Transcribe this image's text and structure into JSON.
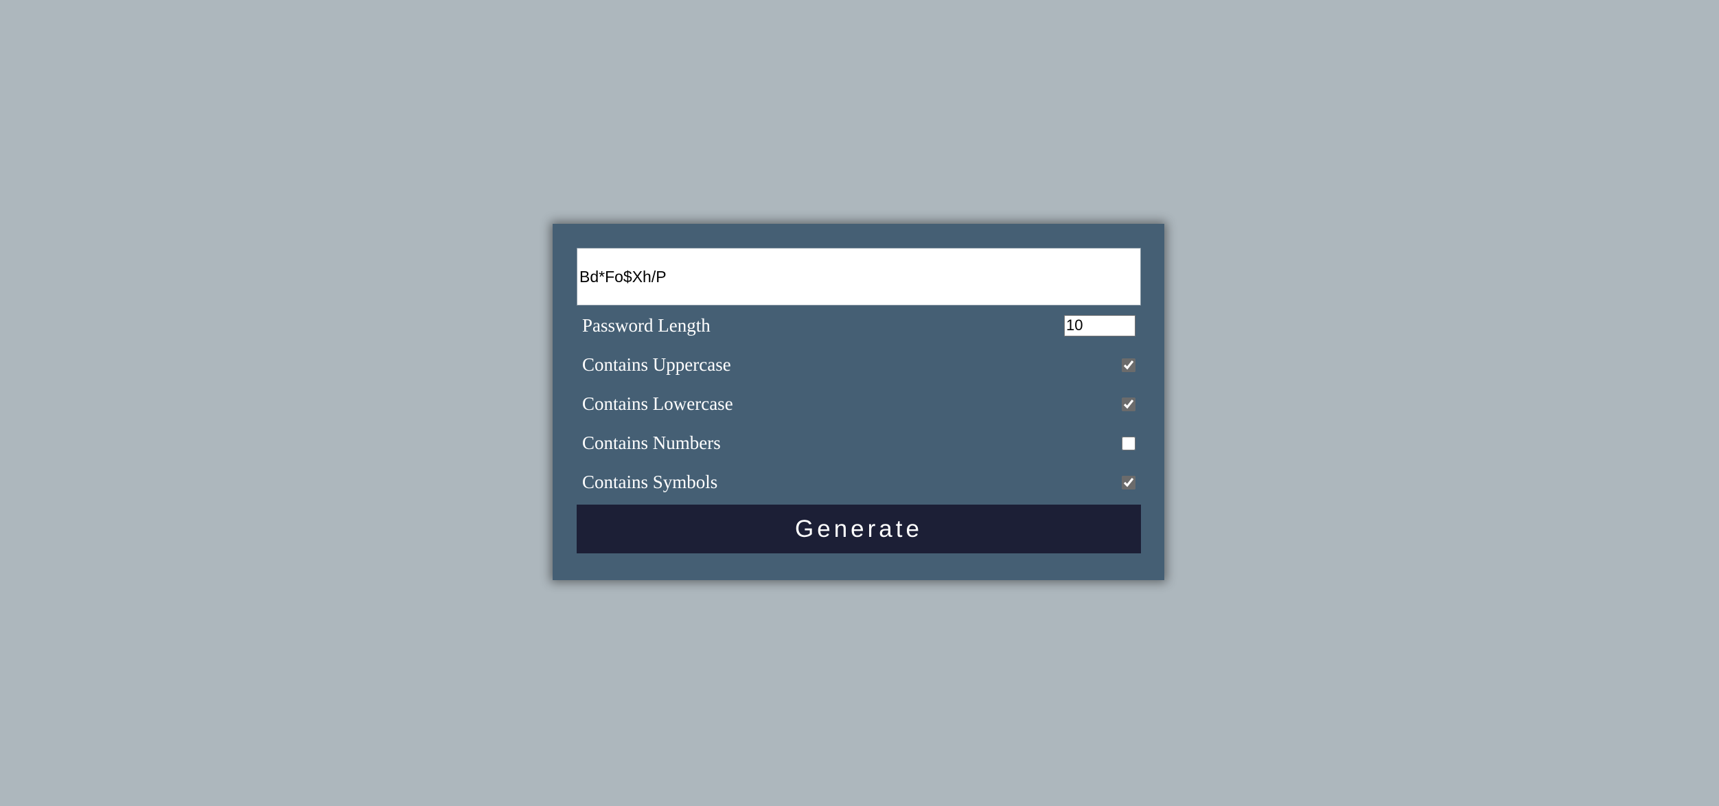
{
  "generator": {
    "password_value": "Bd*Fo$Xh/P",
    "length_label": "Password Length",
    "length_value": "10",
    "options": [
      {
        "label": "Contains Uppercase",
        "checked": true
      },
      {
        "label": "Contains Lowercase",
        "checked": true
      },
      {
        "label": "Contains Numbers",
        "checked": false
      },
      {
        "label": "Contains Symbols",
        "checked": true
      }
    ],
    "generate_label": "Generate"
  },
  "colors": {
    "page_background": "#adb7bd",
    "card_background": "#455f74",
    "button_background": "#1c1f36",
    "text": "#ffffff"
  }
}
